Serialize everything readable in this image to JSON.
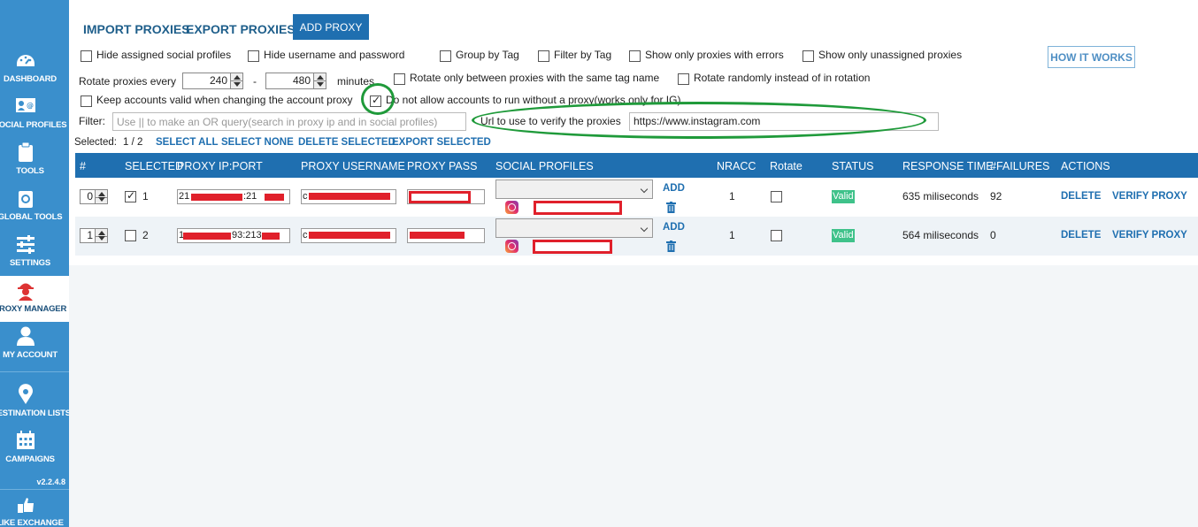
{
  "sidebar": {
    "items": [
      {
        "label": "DASHBOARD",
        "icon": "dashboard-icon"
      },
      {
        "label": "SOCIAL PROFILES",
        "icon": "social-profiles-icon"
      },
      {
        "label": "TOOLS",
        "icon": "tools-icon"
      },
      {
        "label": "GLOBAL TOOLS",
        "icon": "global-tools-icon"
      },
      {
        "label": "SETTINGS",
        "icon": "settings-icon"
      },
      {
        "label": "PROXY MANAGER",
        "icon": "proxy-manager-icon",
        "active": true
      },
      {
        "label": "MY ACCOUNT",
        "icon": "account-icon"
      },
      {
        "label": "DESTINATION LISTS",
        "icon": "location-pin-icon"
      },
      {
        "label": "CAMPAIGNS",
        "icon": "calendar-icon"
      },
      {
        "label": "LIKE EXCHANGE",
        "icon": "like-exchange-icon"
      }
    ],
    "version": "v2.2.4.8"
  },
  "toolbar": {
    "import_label": "IMPORT PROXIES",
    "export_label": "EXPORT PROXIES",
    "add_label": "ADD PROXY",
    "how_it_works_label": "HOW IT WORKS"
  },
  "options": {
    "hide_assigned": "Hide assigned social profiles",
    "hide_credentials": "Hide username and password",
    "group_by_tag": "Group by Tag",
    "filter_by_tag": "Filter by Tag",
    "show_errors": "Show only proxies with errors",
    "show_unassigned": "Show only unassigned proxies",
    "rotate_every": "Rotate proxies every",
    "rotate_min": "240",
    "rotate_dash": "-",
    "rotate_max": "480",
    "minutes": "minutes",
    "rotate_same_tag": "Rotate only between proxies with the same tag name",
    "rotate_random": "Rotate randomly instead of in rotation",
    "keep_valid": "Keep accounts valid when changing the account proxy",
    "no_run_without_proxy": "Do not allow accounts to run without a proxy(works only for IG)",
    "no_run_without_proxy_checked": true,
    "filter_label": "Filter:",
    "filter_placeholder": "Use || to make an OR query(search in proxy ip and in social profiles)",
    "verify_url_label": "Url to use to verify the proxies",
    "verify_url_value": "https://www.instagram.com"
  },
  "selection": {
    "selected_label": "Selected:",
    "selected_count": "1 / 2",
    "select_all": "SELECT ALL",
    "select_none": "SELECT NONE",
    "delete_selected": "DELETE SELECTED",
    "export_selected": "EXPORT SELECTED"
  },
  "table": {
    "headers": [
      "#",
      "SELECTED",
      "PROXY IP:PORT",
      "PROXY USERNAME",
      "PROXY PASS",
      "SOCIAL PROFILES",
      "NRACC",
      "Rotate",
      "STATUS",
      "RESPONSE TIME",
      "#FAILURES",
      "ACTIONS"
    ],
    "rows": [
      {
        "order": "0",
        "selected": true,
        "index": "1",
        "ip_prefix": "21",
        "ip_suffix": ":21",
        "user_prefix": "c",
        "add_label": "ADD",
        "nracc": "1",
        "rotate": false,
        "status": "Valid",
        "response_time": "635 miliseconds",
        "failures": "92",
        "delete_label": "DELETE",
        "verify_label": "VERIFY PROXY"
      },
      {
        "order": "1",
        "selected": false,
        "index": "2",
        "ip_prefix": "1",
        "ip_suffix": "93:213",
        "user_prefix": "c",
        "add_label": "ADD",
        "nracc": "1",
        "rotate": false,
        "status": "Valid",
        "response_time": "564 miliseconds",
        "failures": "0",
        "delete_label": "DELETE",
        "verify_label": "VERIFY PROXY"
      }
    ]
  },
  "colors": {
    "sidebar": "#3a8fcc",
    "header": "#1f6fb0",
    "valid": "#3fc28a",
    "redaction": "#e0202b",
    "annotation": "#1f9a3a"
  }
}
